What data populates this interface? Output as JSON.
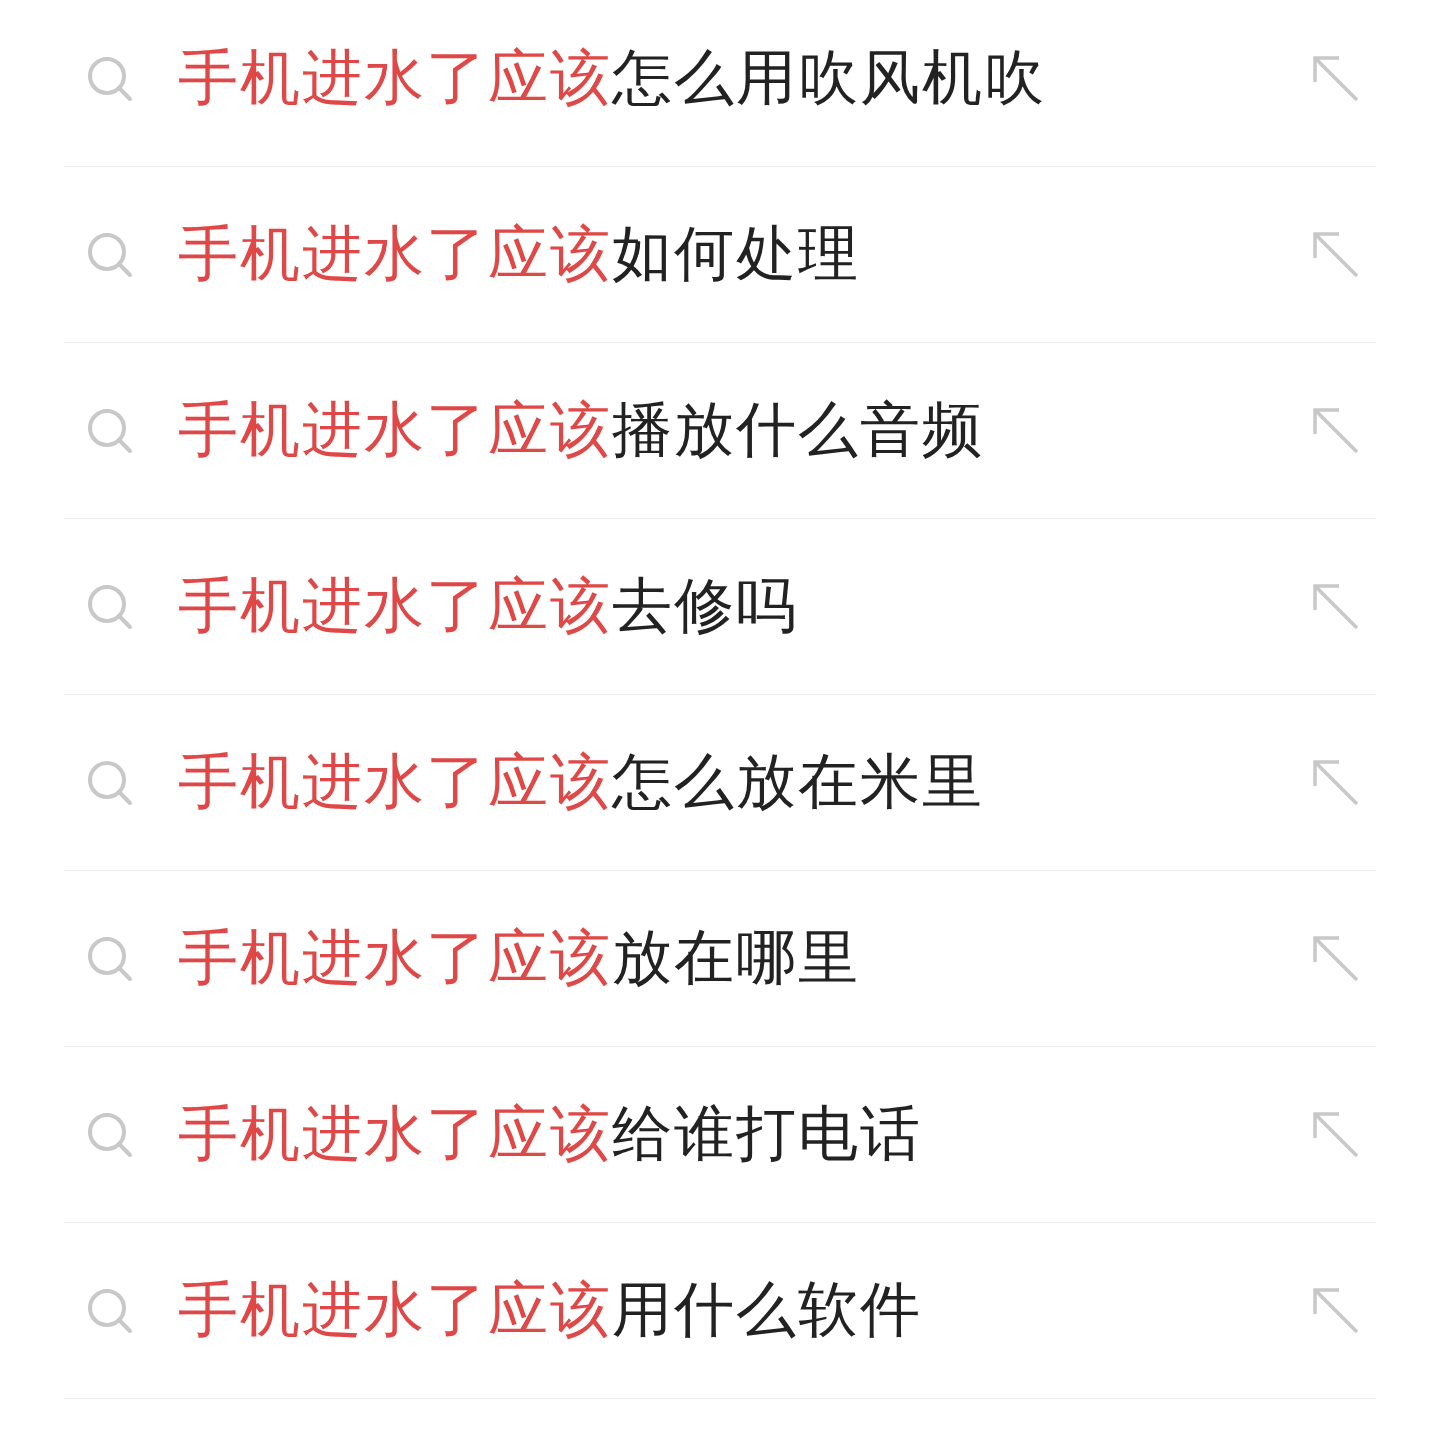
{
  "suggestions": [
    {
      "highlight": "手机进水了应该",
      "rest": "怎么用吹风机吹"
    },
    {
      "highlight": "手机进水了应该",
      "rest": "如何处理"
    },
    {
      "highlight": "手机进水了应该",
      "rest": "播放什么音频"
    },
    {
      "highlight": "手机进水了应该",
      "rest": "去修吗"
    },
    {
      "highlight": "手机进水了应该",
      "rest": "怎么放在米里"
    },
    {
      "highlight": "手机进水了应该",
      "rest": "放在哪里"
    },
    {
      "highlight": "手机进水了应该",
      "rest": "给谁打电话"
    },
    {
      "highlight": "手机进水了应该",
      "rest": "用什么软件"
    }
  ]
}
